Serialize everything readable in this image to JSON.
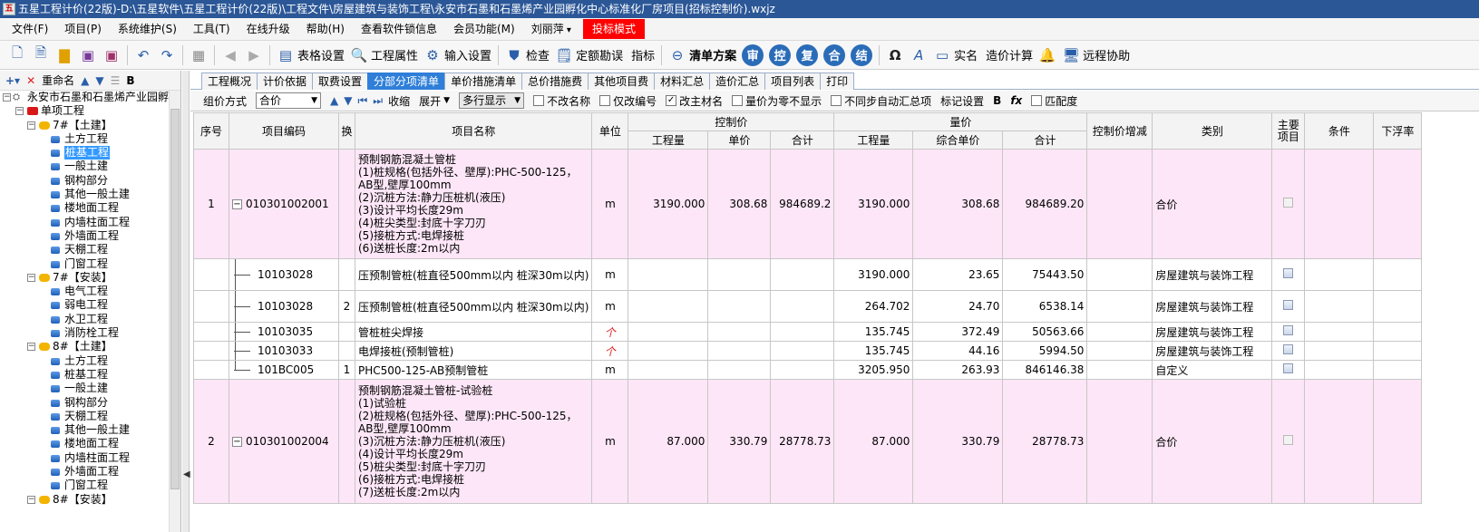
{
  "window": {
    "title": "五星工程计价(22版)-D:\\五星软件\\五星工程计价(22版)\\工程文件\\房屋建筑与装饰工程\\永安市石墨和石墨烯产业园孵化中心标准化厂房项目(招标控制价).wxjz",
    "app_icon": "五"
  },
  "menu": [
    {
      "label": "文件(F)",
      "dd": false
    },
    {
      "label": "项目(P)",
      "dd": false
    },
    {
      "label": "系统维护(S)",
      "dd": false
    },
    {
      "label": "工具(T)",
      "dd": false
    },
    {
      "label": "在线升级",
      "dd": false
    },
    {
      "label": "帮助(H)",
      "dd": false
    },
    {
      "label": "查看软件锁信息",
      "dd": false
    },
    {
      "label": "会员功能(M)",
      "dd": false
    },
    {
      "label": "刘丽萍",
      "dd": true
    }
  ],
  "menu_red": "投标模式",
  "toolbar": {
    "table_settings": "表格设置",
    "project_props": "工程属性",
    "input_settings": "输入设置",
    "check": "检查",
    "quota_survey": "定额勘误",
    "indicator": "指标",
    "list_plan": "清单方案",
    "c1": "审",
    "c2": "控",
    "c3": "复",
    "c4": "合",
    "c5": "结",
    "omega": "Ω",
    "font_a": "A",
    "realname": "实名",
    "cost_calc": "造价计算",
    "remote": "远程协助"
  },
  "left": {
    "toolbar_rename": "重命名",
    "bold": "B",
    "root": "永安市石墨和石墨烯产业园孵",
    "single": "单项工程",
    "groups": [
      {
        "label": "7#【土建】",
        "items": [
          "土方工程",
          "桩基工程",
          "一般土建",
          "钢构部分",
          "其他一般土建",
          "楼地面工程",
          "内墙柱面工程",
          "外墙面工程",
          "天棚工程",
          "门窗工程"
        ]
      },
      {
        "label": "7#【安装】",
        "items": [
          "电气工程",
          "弱电工程",
          "水卫工程",
          "消防栓工程"
        ]
      },
      {
        "label": "8#【土建】",
        "items": [
          "土方工程",
          "桩基工程",
          "一般土建",
          "钢构部分",
          "天棚工程",
          "其他一般土建",
          "楼地面工程",
          "内墙柱面工程",
          "外墙面工程",
          "门窗工程"
        ]
      },
      {
        "label": "8#【安装】",
        "items": []
      }
    ],
    "selected": "桩基工程"
  },
  "tabs": [
    "工程概况",
    "计价依据",
    "取费设置",
    "分部分项清单",
    "单价措施清单",
    "总价措施费",
    "其他项目费",
    "材料汇总",
    "造价汇总",
    "项目列表",
    "打印"
  ],
  "active_tab": "分部分项清单",
  "options": {
    "group_label": "组价方式",
    "group_value": "合价",
    "collapse": "收缩",
    "expand": "展开",
    "multiline": "多行显示",
    "no_rename": "不改名称",
    "only_code": "仅改编号",
    "change_mat": "改主材名",
    "zero_hide": "量价为零不显示",
    "no_sync": "不同步自动汇总项",
    "mark_settings": "标记设置",
    "bold": "B",
    "fx": "fx",
    "match": "匹配度",
    "change_mat_checked": true
  },
  "grid": {
    "headers": {
      "seq": "序号",
      "code": "项目编码",
      "swap": "换",
      "name": "项目名称",
      "unit": "单位",
      "control": "控制价",
      "qty": "量价",
      "c_qty": "工程量",
      "c_price": "单价",
      "c_total": "合计",
      "q_qty": "工程量",
      "q_price": "综合单价",
      "q_total": "合计",
      "delta": "控制价增减",
      "category": "类别",
      "main": "主要项目",
      "cond": "条件",
      "float": "下浮率"
    },
    "rows": [
      {
        "kind": "main",
        "seq": "1",
        "code": "010301002001",
        "swap": "",
        "name": "预制钢筋混凝土管桩\n(1)桩规格(包括外径、壁厚):PHC-500-125，AB型,壁厚100mm\n(2)沉桩方法:静力压桩机(液压)\n(3)设计平均长度29m\n(4)桩尖类型:封底十字刀刃\n(5)接桩方式:电焊接桩\n(6)送桩长度:2m以内",
        "unit": "m",
        "c_qty": "3190.000",
        "c_price": "308.68",
        "c_total": "984689.2",
        "q_qty": "3190.000",
        "q_price": "308.68",
        "q_total": "984689.20",
        "delta": "",
        "category": "合价"
      },
      {
        "kind": "sub",
        "seq": "",
        "code": "10103028",
        "swap": "",
        "name": "压预制管桩(桩直径500mm以内 桩深30m以内)",
        "unit": "m",
        "c_qty": "",
        "c_price": "",
        "c_total": "",
        "q_qty": "3190.000",
        "q_price": "23.65",
        "q_total": "75443.50",
        "delta": "",
        "category": "房屋建筑与装饰工程"
      },
      {
        "kind": "sub",
        "seq": "",
        "code": "10103028",
        "swap": "2",
        "name": "压预制管桩(桩直径500mm以内 桩深30m以内)",
        "unit": "m",
        "c_qty": "",
        "c_price": "",
        "c_total": "",
        "q_qty": "264.702",
        "q_price": "24.70",
        "q_total": "6538.14",
        "delta": "",
        "category": "房屋建筑与装饰工程"
      },
      {
        "kind": "sub",
        "seq": "",
        "code": "10103035",
        "swap": "",
        "name": "管桩桩尖焊接",
        "unit": "个",
        "c_qty": "",
        "c_price": "",
        "c_total": "",
        "q_qty": "135.745",
        "q_price": "372.49",
        "q_total": "50563.66",
        "delta": "",
        "category": "房屋建筑与装饰工程"
      },
      {
        "kind": "sub",
        "seq": "",
        "code": "10103033",
        "swap": "",
        "name": "电焊接桩(预制管桩)",
        "unit": "个",
        "c_qty": "",
        "c_price": "",
        "c_total": "",
        "q_qty": "135.745",
        "q_price": "44.16",
        "q_total": "5994.50",
        "delta": "",
        "category": "房屋建筑与装饰工程"
      },
      {
        "kind": "sub-last",
        "seq": "",
        "code": "101BC005",
        "swap": "1",
        "name": "PHC500-125-AB预制管桩",
        "unit": "m",
        "c_qty": "",
        "c_price": "",
        "c_total": "",
        "q_qty": "3205.950",
        "q_price": "263.93",
        "q_total": "846146.38",
        "delta": "",
        "category": "自定义"
      },
      {
        "kind": "main",
        "seq": "2",
        "code": "010301002004",
        "swap": "",
        "name": "预制钢筋混凝土管桩-试验桩\n(1)试验桩\n(2)桩规格(包括外径、壁厚):PHC-500-125，AB型,壁厚100mm\n(3)沉桩方法:静力压桩机(液压)\n(4)设计平均长度29m\n(5)桩尖类型:封底十字刀刃\n(6)接桩方式:电焊接桩\n(7)送桩长度:2m以内",
        "unit": "m",
        "c_qty": "87.000",
        "c_price": "330.79",
        "c_total": "28778.73",
        "q_qty": "87.000",
        "q_price": "330.79",
        "q_total": "28778.73",
        "delta": "",
        "category": "合价"
      }
    ]
  }
}
